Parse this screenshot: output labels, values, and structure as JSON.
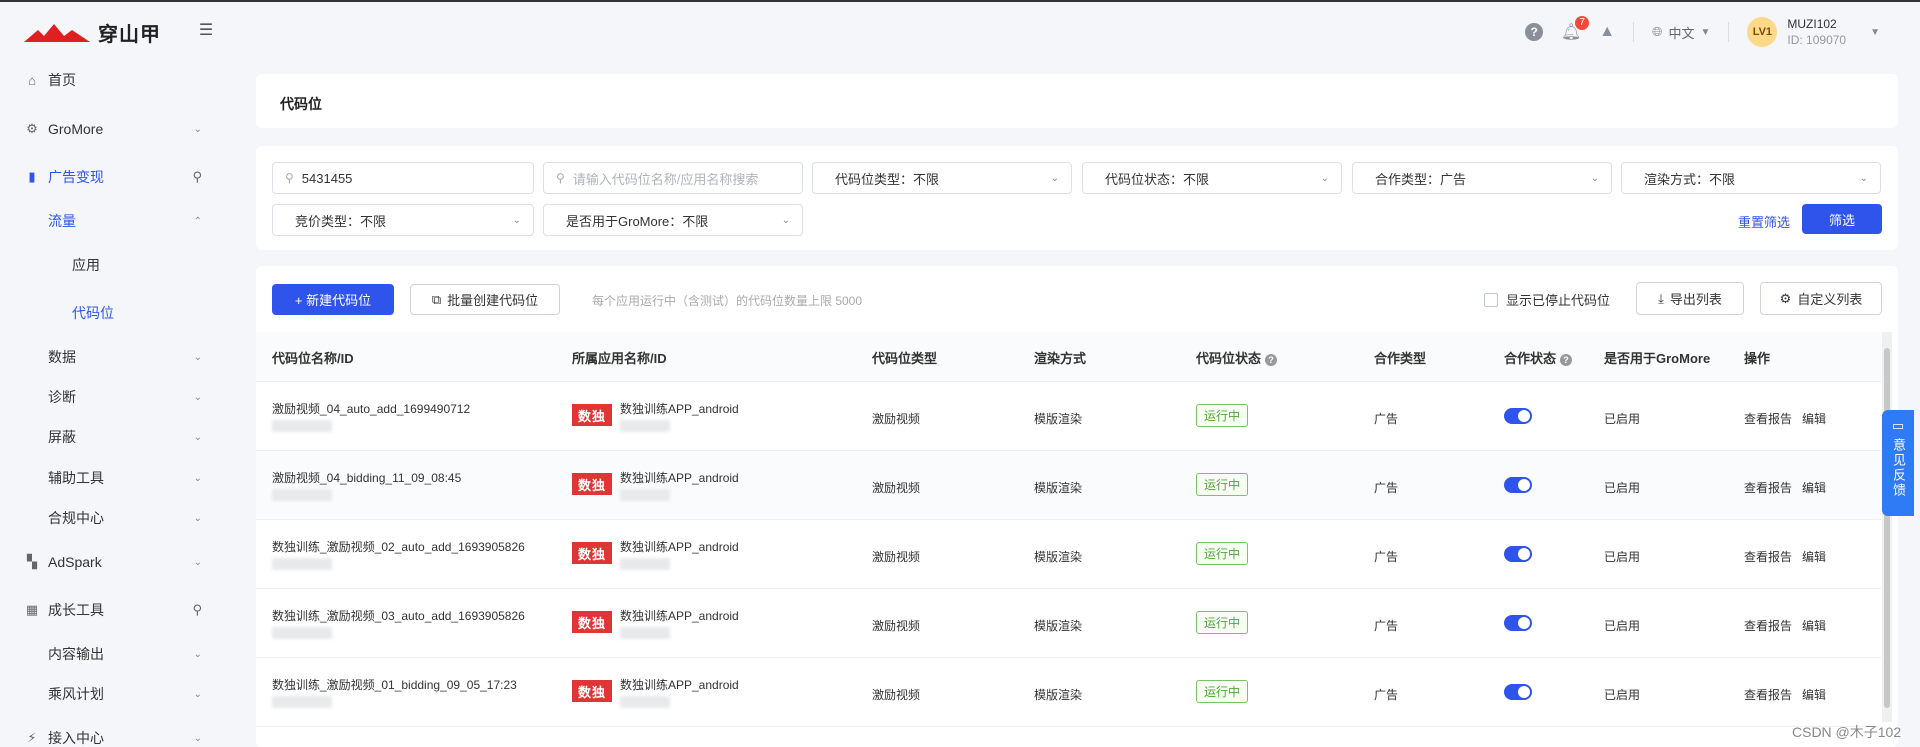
{
  "header": {
    "logo_text": "穿山甲",
    "notification_count": "7",
    "language": "中文",
    "avatar_text": "LV1",
    "user_name": "MUZI102",
    "user_id": "ID: 109070"
  },
  "sidebar": {
    "home": "首页",
    "gromore": "GroMore",
    "ad_monetization": "广告变现",
    "traffic": "流量",
    "apps": "应用",
    "ad_slots": "代码位",
    "data": "数据",
    "diagnosis": "诊断",
    "block": "屏蔽",
    "tools": "辅助工具",
    "compliance": "合规中心",
    "adspark": "AdSpark",
    "growth_tools": "成长工具",
    "content_output": "内容输出",
    "ride_wind": "乘风计划",
    "access_center": "接入中心"
  },
  "page": {
    "title": "代码位"
  },
  "filters": {
    "search_value": "5431455",
    "search_placeholder": "请输入代码位名称/应用名称搜索",
    "slot_type": "代码位类型：不限",
    "slot_status": "代码位状态：不限",
    "coop_type": "合作类型：广告",
    "render": "渲染方式：不限",
    "bid_type": "竞价类型：不限",
    "gromore": "是否用于GroMore：不限",
    "reset": "重置筛选",
    "submit": "筛选"
  },
  "toolbar": {
    "new_slot": "+ 新建代码位",
    "batch_create": "批量创建代码位",
    "limit_note": "每个应用运行中（含测试）的代码位数量上限 5000",
    "show_stopped": "显示已停止代码位",
    "export": "导出列表",
    "customize": "自定义列表"
  },
  "table": {
    "headers": {
      "name": "代码位名称/ID",
      "app": "所属应用名称/ID",
      "type": "代码位类型",
      "render": "渲染方式",
      "status": "代码位状态",
      "coop_type": "合作类型",
      "coop_status": "合作状态",
      "gromore": "是否用于GroMore",
      "actions": "操作"
    },
    "rows": [
      {
        "name": "激励视频_04_auto_add_1699490712",
        "app_badge": "数独",
        "app": "数独训练APP_android",
        "type": "激励视频",
        "render": "模版渲染",
        "status": "运行中",
        "coop_type": "广告",
        "gromore": "已启用",
        "report": "查看报告",
        "edit": "编辑"
      },
      {
        "name": "激励视频_04_bidding_11_09_08:45",
        "app_badge": "数独",
        "app": "数独训练APP_android",
        "type": "激励视频",
        "render": "模版渲染",
        "status": "运行中",
        "coop_type": "广告",
        "gromore": "已启用",
        "report": "查看报告",
        "edit": "编辑"
      },
      {
        "name": "数独训练_激励视频_02_auto_add_1693905826",
        "app_badge": "数独",
        "app": "数独训练APP_android",
        "type": "激励视频",
        "render": "模版渲染",
        "status": "运行中",
        "coop_type": "广告",
        "gromore": "已启用",
        "report": "查看报告",
        "edit": "编辑"
      },
      {
        "name": "数独训练_激励视频_03_auto_add_1693905826",
        "app_badge": "数独",
        "app": "数独训练APP_android",
        "type": "激励视频",
        "render": "模版渲染",
        "status": "运行中",
        "coop_type": "广告",
        "gromore": "已启用",
        "report": "查看报告",
        "edit": "编辑"
      },
      {
        "name": "数独训练_激励视频_01_bidding_09_05_17:23",
        "app_badge": "数独",
        "app": "数独训练APP_android",
        "type": "激励视频",
        "render": "模版渲染",
        "status": "运行中",
        "coop_type": "广告",
        "gromore": "已启用",
        "report": "查看报告",
        "edit": "编辑"
      }
    ]
  },
  "feedback": "意见反馈",
  "watermark": "CSDN @木子102"
}
